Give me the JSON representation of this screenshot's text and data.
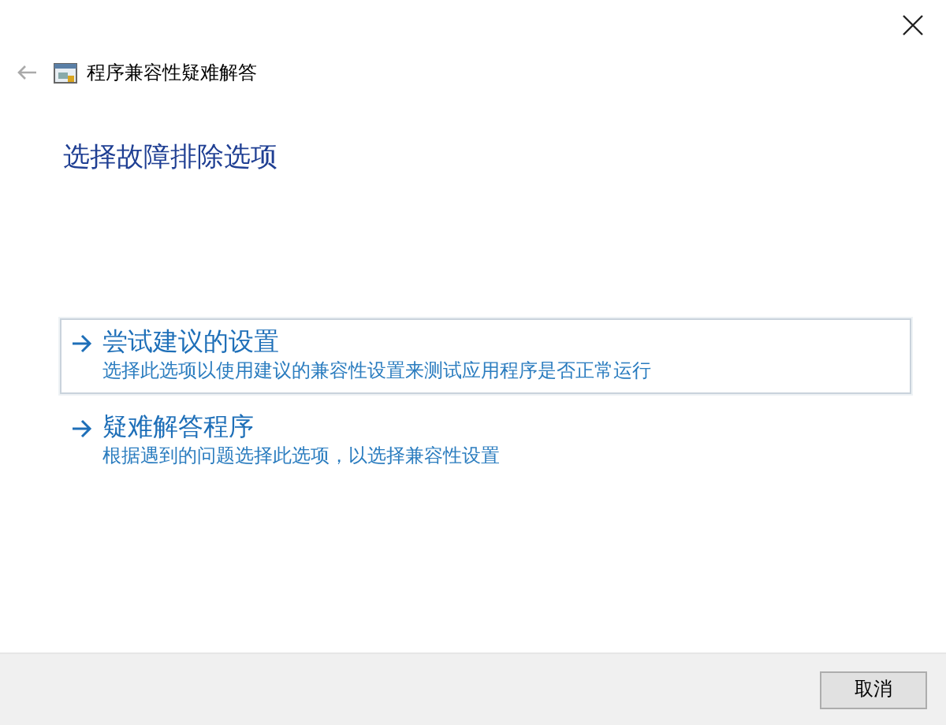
{
  "window": {
    "title": "程序兼容性疑难解答"
  },
  "heading": "选择故障排除选项",
  "options": [
    {
      "title": "尝试建议的设置",
      "description": "选择此选项以使用建议的兼容性设置来测试应用程序是否正常运行",
      "selected": true
    },
    {
      "title": "疑难解答程序",
      "description": "根据遇到的问题选择此选项，以选择兼容性设置",
      "selected": false
    }
  ],
  "buttons": [
    "取消"
  ]
}
